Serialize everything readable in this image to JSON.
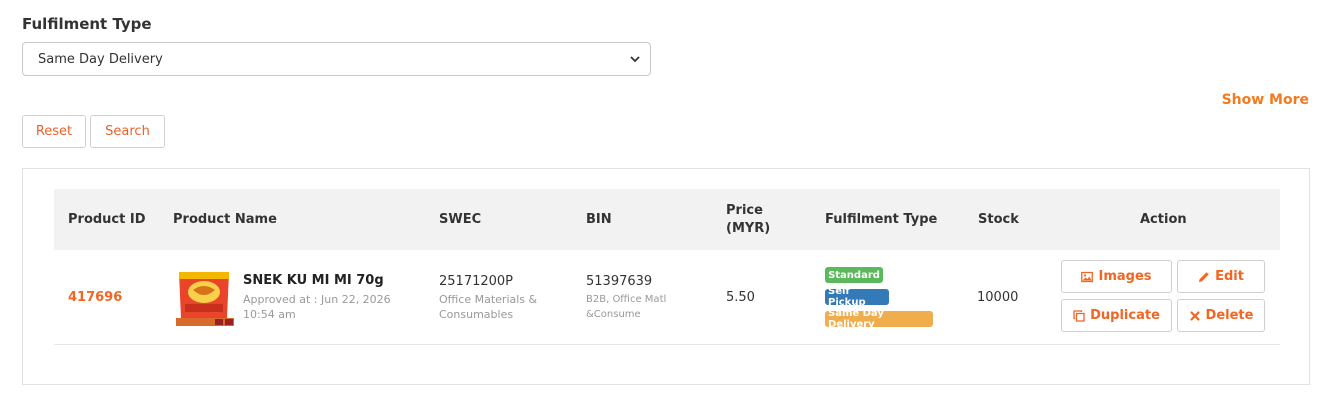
{
  "filter": {
    "label": "Fulfilment Type",
    "selected": "Same Day Delivery"
  },
  "show_more": "Show More",
  "buttons": {
    "reset": "Reset",
    "search": "Search"
  },
  "table": {
    "headers": {
      "product_id": "Product ID",
      "product_name": "Product Name",
      "swec": "SWEC",
      "bin": "BIN",
      "price_line1": "Price",
      "price_line2": "(MYR)",
      "fulfilment": "Fulfilment Type",
      "stock": "Stock",
      "action": "Action"
    },
    "rows": [
      {
        "product_id": "417696",
        "name": "SNEK KU MI MI 70g",
        "approved_line1": "Approved at : Jun 22, 2026",
        "approved_line2": "10:54 am",
        "swec_code": "25171200P",
        "swec_desc_line1": "Office Materials &",
        "swec_desc_line2": "Consumables",
        "bin_code": "51397639",
        "bin_desc_line1": "B2B, Office Matl",
        "bin_desc_line2": "&Consume",
        "price": "5.50",
        "badges": [
          {
            "label": "Standard",
            "color": "#5cb85c"
          },
          {
            "label": "Self Pickup",
            "color": "#337ab7"
          },
          {
            "label": "Same Day Delivery",
            "color": "#f0ad4e"
          }
        ],
        "stock": "10000",
        "actions": {
          "images": "Images",
          "edit": "Edit",
          "duplicate": "Duplicate",
          "delete": "Delete"
        },
        "thumbnail_icon": "product-package-icon"
      }
    ]
  },
  "colors": {
    "accent": "#f26522",
    "header_bg": "#f2f2f2"
  }
}
